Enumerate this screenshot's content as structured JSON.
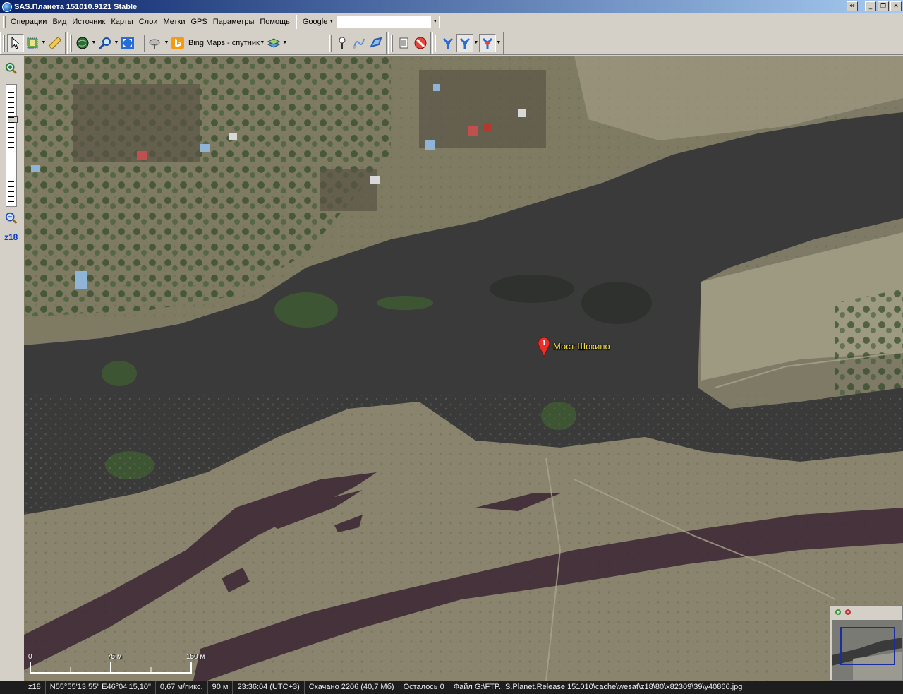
{
  "window": {
    "title": "SAS.Планета 151010.9121 Stable",
    "buttons": [
      "⇔",
      "_",
      "❐",
      "✕"
    ]
  },
  "menu": {
    "items": [
      "Операции",
      "Вид",
      "Источник",
      "Карты",
      "Слои",
      "Метки",
      "GPS",
      "Параметры",
      "Помощь"
    ],
    "search_provider": "Google",
    "search_value": ""
  },
  "toolbar": {
    "map_source": "Bing Maps - спутник"
  },
  "zoom": {
    "label": "z18",
    "level_fraction": 0.28
  },
  "map": {
    "marker_number": "1",
    "marker_label": "Мост Шокино",
    "scale": {
      "zero": "0",
      "mid": "75 м",
      "end": "150 м"
    }
  },
  "status": {
    "zoom": "z18",
    "coords": "N55°55'13,55\" E46°04'15,10\"",
    "resolution": "0,67 м/пикс.",
    "elevation": "90 м",
    "time": "23:36:04 (UTC+3)",
    "downloaded": "Скачано 2206 (40,7 Мб)",
    "remaining": "Осталось 0",
    "file": "Файл G:\\FTP...S.Planet.Release.151010\\cache\\wesat\\z18\\80\\x82309\\39\\y40866.jpg"
  },
  "colors": {
    "water": "#3a3a3a",
    "titlebar_start": "#0a246a",
    "marker_red": "#e8302a",
    "marker_label": "#f5e040"
  }
}
